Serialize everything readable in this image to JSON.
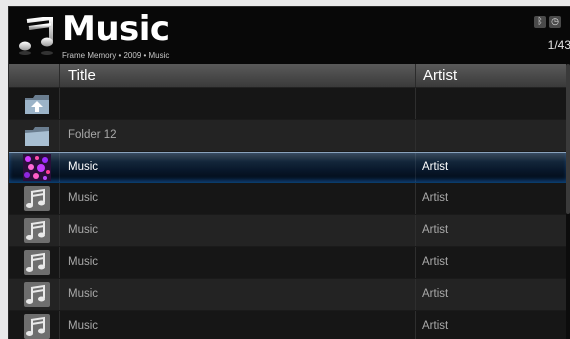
{
  "header": {
    "title": "Music",
    "subtitle": "Frame Memory • 2009 • Music",
    "page_counter": "1/43",
    "status_icons": [
      "bluetooth-icon",
      "clock-icon"
    ]
  },
  "columns": {
    "title": "Title",
    "artist": "Artist"
  },
  "rows": [
    {
      "type": "folder-up",
      "title": "",
      "artist": ""
    },
    {
      "type": "folder",
      "title": "Folder 12",
      "artist": ""
    },
    {
      "type": "album-art",
      "title": "Music",
      "artist": "Artist",
      "selected": true
    },
    {
      "type": "music",
      "title": "Music",
      "artist": "Artist"
    },
    {
      "type": "music",
      "title": "Music",
      "artist": "Artist"
    },
    {
      "type": "music",
      "title": "Music",
      "artist": "Artist"
    },
    {
      "type": "music",
      "title": "Music",
      "artist": "Artist"
    },
    {
      "type": "music",
      "title": "Music",
      "artist": "Artist"
    }
  ],
  "colors": {
    "background": "#0c0c0c",
    "selection": "#0a3c6a",
    "text": "#a9a9a9"
  }
}
